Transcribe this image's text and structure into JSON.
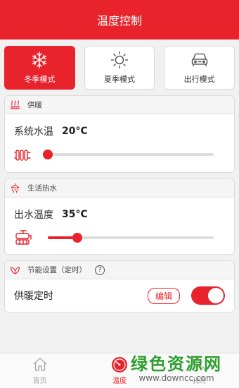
{
  "header": {
    "title": "温度控制"
  },
  "modes": [
    {
      "label": "冬季模式",
      "icon": "snowflake-icon",
      "active": true
    },
    {
      "label": "夏季模式",
      "icon": "sun-icon",
      "active": false
    },
    {
      "label": "出行模式",
      "icon": "car-icon",
      "active": false
    }
  ],
  "heating": {
    "section_title": "供暖",
    "temp_label": "系统水温",
    "temp_value": "20°C",
    "slider_percent": 0,
    "icon": "radiator-icon"
  },
  "hot_water": {
    "section_title": "生活热水",
    "temp_label": "出水温度",
    "temp_value": "35°C",
    "slider_percent": 18,
    "icon": "faucet-icon"
  },
  "energy": {
    "section_title": "节能设置（定时）",
    "help_label": "?",
    "timer_label": "供暖定时",
    "edit_label": "编辑",
    "timer_enabled": true
  },
  "tabbar": [
    {
      "label": "首页",
      "icon": "home-icon",
      "active": false
    },
    {
      "label": "温度",
      "icon": "gauge-icon",
      "active": true
    },
    {
      "label": "我的",
      "icon": "user-icon",
      "active": false
    }
  ],
  "watermark": {
    "main": "绿色资源网",
    "sub": "www.downcc.com"
  },
  "colors": {
    "accent": "#e8232c",
    "background": "#f1f1f1"
  }
}
